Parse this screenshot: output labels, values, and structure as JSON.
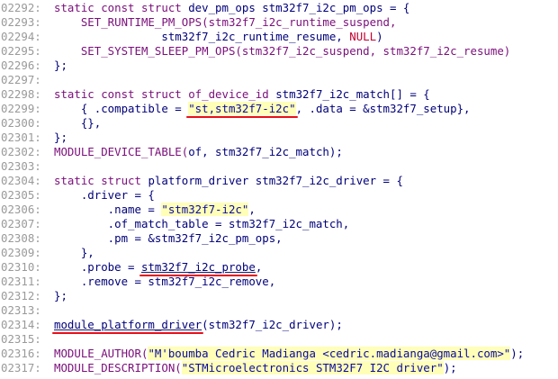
{
  "editor": {
    "lines": [
      {
        "n": "02292:",
        "segs": [
          {
            "t": "static ",
            "c": "kw"
          },
          {
            "t": "const ",
            "c": "kw"
          },
          {
            "t": "struct ",
            "c": "kw"
          },
          {
            "t": "dev_pm_ops stm32f7_i2c_pm_ops = {"
          }
        ]
      },
      {
        "n": "02293:",
        "segs": [
          {
            "t": "    SET_RUNTIME_PM_OPS(stm32f7_i2c_runtime_suspend,",
            "c": "mac"
          }
        ]
      },
      {
        "n": "02294:",
        "segs": [
          {
            "t": "                stm32f7_i2c_runtime_resume, "
          },
          {
            "t": "NULL",
            "c": "nul"
          },
          {
            "t": ")"
          }
        ]
      },
      {
        "n": "02295:",
        "segs": [
          {
            "t": "    SET_SYSTEM_SLEEP_PM_OPS(stm32f7_i2c_suspend, stm32f7_i2c_resume)",
            "c": "mac"
          }
        ]
      },
      {
        "n": "02296:",
        "segs": [
          {
            "t": "};"
          }
        ]
      },
      {
        "n": "02297:",
        "segs": []
      },
      {
        "n": "02298:",
        "segs": [
          {
            "t": "static ",
            "c": "kw"
          },
          {
            "t": "const ",
            "c": "kw"
          },
          {
            "t": "struct ",
            "c": "kw"
          },
          {
            "t": "of_device_id",
            "c": "kw"
          },
          {
            "t": " stm32f7_i2c_match[] = {"
          }
        ]
      },
      {
        "n": "02299:",
        "segs": [
          {
            "t": "    { .compatible = "
          },
          {
            "t": "\"st,stm32f7-i2c\"",
            "c": "str",
            "mark": "compat"
          },
          {
            "t": ", .data = &stm32f7_setup},"
          }
        ]
      },
      {
        "n": "02300:",
        "segs": [
          {
            "t": "    {},"
          }
        ]
      },
      {
        "n": "02301:",
        "segs": [
          {
            "t": "};"
          }
        ]
      },
      {
        "n": "02302:",
        "segs": [
          {
            "t": "MODULE_DEVICE_TABLE(",
            "c": "mac"
          },
          {
            "t": "of, stm32f7_i2c_match);"
          }
        ]
      },
      {
        "n": "02303:",
        "segs": []
      },
      {
        "n": "02304:",
        "segs": [
          {
            "t": "static ",
            "c": "kw"
          },
          {
            "t": "struct ",
            "c": "kw"
          },
          {
            "t": "platform_driver stm32f7_i2c_driver = {"
          }
        ]
      },
      {
        "n": "02305:",
        "segs": [
          {
            "t": "    .driver = {"
          }
        ]
      },
      {
        "n": "02306:",
        "segs": [
          {
            "t": "        .name = "
          },
          {
            "t": "\"stm32f7-i2c\"",
            "c": "str"
          },
          {
            "t": ","
          }
        ]
      },
      {
        "n": "02307:",
        "segs": [
          {
            "t": "        .of_match_table = stm32f7_i2c_match,"
          }
        ]
      },
      {
        "n": "02308:",
        "segs": [
          {
            "t": "        .pm = &stm32f7_i2c_pm_ops,"
          }
        ]
      },
      {
        "n": "02309:",
        "segs": [
          {
            "t": "    },"
          }
        ]
      },
      {
        "n": "02310:",
        "segs": [
          {
            "t": "    .probe = "
          },
          {
            "t": "stm32f7_i2c_probe",
            "c": "ul",
            "mark": "probe"
          },
          {
            "t": ","
          }
        ]
      },
      {
        "n": "02311:",
        "segs": [
          {
            "t": "    .remove = stm32f7_i2c_remove,"
          }
        ]
      },
      {
        "n": "02312:",
        "segs": [
          {
            "t": "};"
          }
        ]
      },
      {
        "n": "02313:",
        "segs": []
      },
      {
        "n": "02314:",
        "segs": [
          {
            "t": "module_platform_driver",
            "c": "ul",
            "mark": "mpd"
          },
          {
            "t": "(stm32f7_i2c_driver);"
          }
        ]
      },
      {
        "n": "02315:",
        "segs": []
      },
      {
        "n": "02316:",
        "segs": [
          {
            "t": "MODULE_AUTHOR(",
            "c": "mac"
          },
          {
            "t": "\"M'boumba Cedric Madianga <cedric.madianga@gmail.com>\"",
            "c": "str"
          },
          {
            "t": ");"
          }
        ]
      },
      {
        "n": "02317:",
        "segs": [
          {
            "t": "MODULE_DESCRIPTION(",
            "c": "mac"
          },
          {
            "t": "\"STMicroelectronics STM32F7 I2C driver\"",
            "c": "str"
          },
          {
            "t": ");"
          }
        ]
      }
    ]
  },
  "colors": {
    "keyword": "#7a0f7a",
    "identifier": "#00007a",
    "string_bg": "#ffffb8",
    "line_number": "#9a9a9a",
    "annotation_red": "#e8101a"
  }
}
